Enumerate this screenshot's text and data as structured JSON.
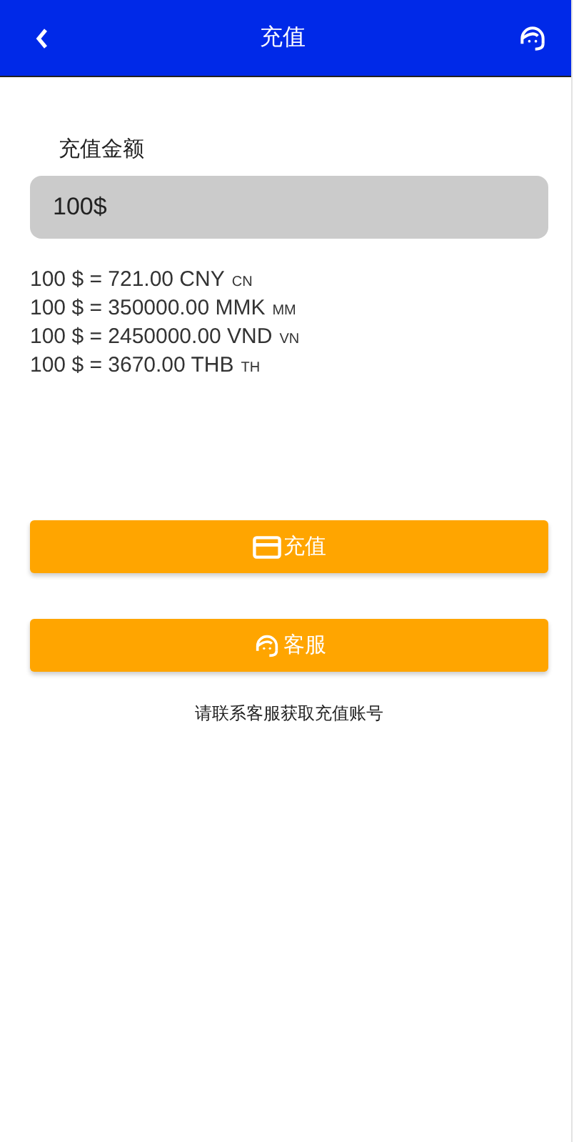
{
  "header": {
    "title": "充值"
  },
  "amount": {
    "label": "充值金额",
    "value": "100$"
  },
  "rates": [
    {
      "text": "100 $ = 721.00 CNY",
      "code": "CN"
    },
    {
      "text": "100 $ = 350000.00 MMK",
      "code": "MM"
    },
    {
      "text": "100 $ = 2450000.00 VND",
      "code": "VN"
    },
    {
      "text": "100 $ = 3670.00 THB",
      "code": "TH"
    }
  ],
  "buttons": [
    {
      "kind": "card",
      "label": "充值"
    },
    {
      "kind": "support",
      "label": "客服"
    }
  ],
  "note": "请联系客服获取充值账号"
}
